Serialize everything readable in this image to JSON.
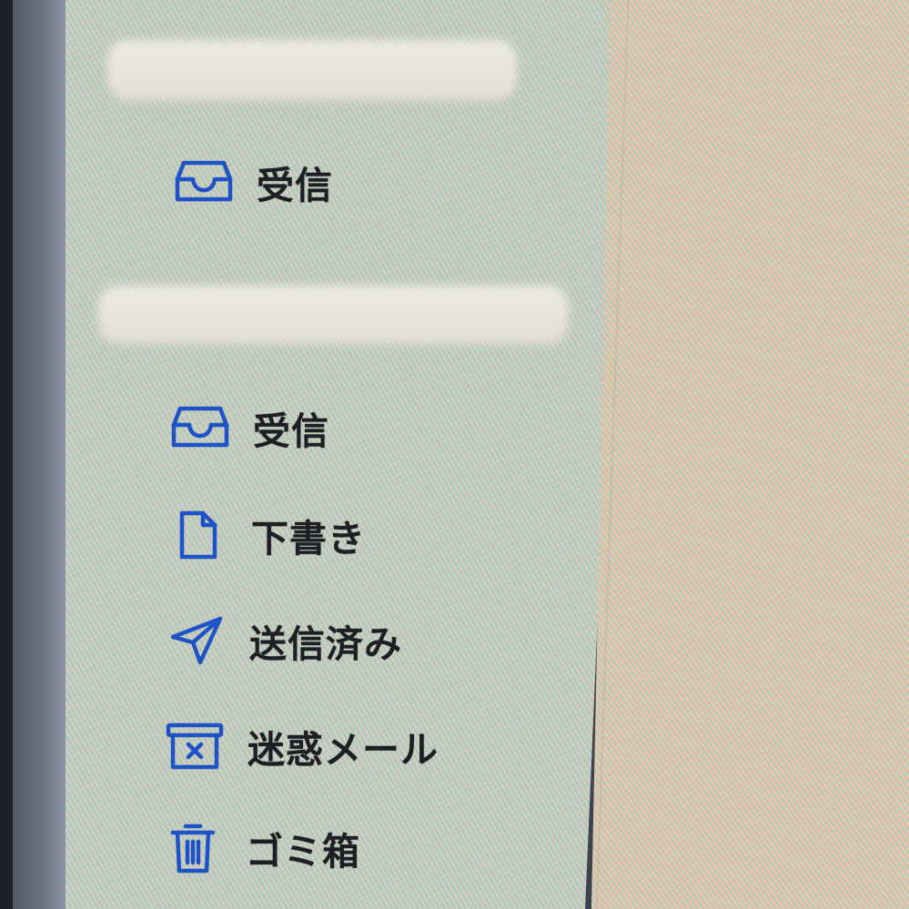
{
  "sidebar": {
    "accounts": [
      {
        "folders": [
          {
            "icon": "inbox-icon",
            "label": "受信"
          }
        ]
      },
      {
        "folders": [
          {
            "icon": "inbox-icon",
            "label": "受信"
          },
          {
            "icon": "document-icon",
            "label": "下書き"
          },
          {
            "icon": "paper-plane-icon",
            "label": "送信済み"
          },
          {
            "icon": "junk-box-icon",
            "label": "迷惑メール"
          },
          {
            "icon": "trash-icon",
            "label": "ゴミ箱"
          }
        ]
      }
    ]
  },
  "colors": {
    "icon": "#1f52c4",
    "label": "#1e1f24"
  }
}
